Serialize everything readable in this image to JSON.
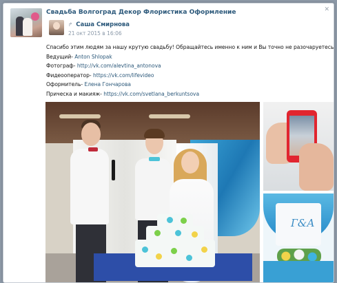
{
  "group": {
    "title": "Свадьба Волгоград Декор Флористика Оформление",
    "close_label": "✕"
  },
  "author": {
    "reply_icon_char": "↱",
    "name": "Саша Смирнова",
    "date": "21 окт 2015 в 16:06"
  },
  "post": {
    "intro": "Спасибо этим людям за нашу крутую свадьбу! Обращайтесь именно к ним и Вы точно не разочаруетесь!",
    "credits": [
      {
        "role": "Ведущий-",
        "value": "Anton Shlopak"
      },
      {
        "role": "Фотограф-",
        "value": "http://vk.com/alevtina_antonova"
      },
      {
        "role": "Фидеооператор-",
        "value": "https://vk.com/lifevideo"
      },
      {
        "role": "Оформитель-",
        "value": "Елена Гончарова"
      },
      {
        "role": "Прическа и макияж-",
        "value": "https://vk.com/svetlana_berkuntsova"
      }
    ]
  },
  "photos": {
    "decor_monogram": "Г&А"
  },
  "colors": {
    "link": "#2b587a",
    "page_bg": "#8c98a6"
  }
}
